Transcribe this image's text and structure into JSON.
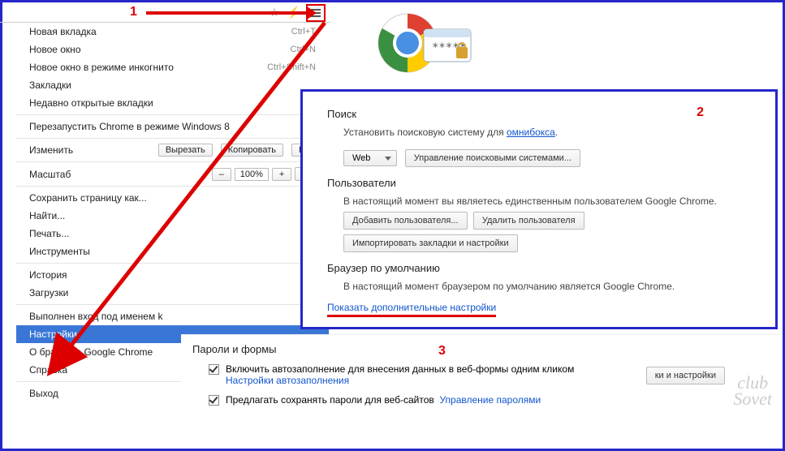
{
  "steps": {
    "one": "1",
    "two": "2",
    "three": "3"
  },
  "menu": {
    "new_tab": {
      "label": "Новая вкладка",
      "shortcut": "Ctrl+T"
    },
    "new_window": {
      "label": "Новое окно",
      "shortcut": "Ctrl+N"
    },
    "incognito": {
      "label": "Новое окно в режиме инкогнито",
      "shortcut": "Ctrl+Shift+N"
    },
    "bookmarks": {
      "label": "Закладки"
    },
    "recent_tabs": {
      "label": "Недавно открытые вкладки"
    },
    "relaunch_win8": {
      "label": "Перезапустить Chrome в режиме Windows 8"
    },
    "edit_label": "Изменить",
    "cut": "Вырезать",
    "copy": "Копировать",
    "paste_prefix": "Вст",
    "zoom_label": "Масштаб",
    "zoom_minus": "–",
    "zoom_value": "100%",
    "zoom_plus": "+",
    "save_page": {
      "label": "Сохранить страницу как..."
    },
    "find": {
      "label": "Найти..."
    },
    "print": {
      "label": "Печать..."
    },
    "tools": {
      "label": "Инструменты"
    },
    "history": {
      "label": "История"
    },
    "downloads": {
      "label": "Загрузки"
    },
    "signed_in_prefix": "Выполнен вход под именем k",
    "settings": {
      "label": "Настройки"
    },
    "about": {
      "label": "О браузере Google Chrome"
    },
    "help": {
      "label": "Справка"
    },
    "exit": {
      "label": "Выход"
    }
  },
  "settings": {
    "search": {
      "heading": "Поиск",
      "desc_prefix": "Установить поисковую систему для ",
      "omnibox_link": "омнибокса",
      "desc_suffix": ".",
      "engine_selected": "Web",
      "manage_btn": "Управление поисковыми системами..."
    },
    "users": {
      "heading": "Пользователи",
      "desc": "В настоящий момент вы являетесь единственным пользователем Google Chrome.",
      "add_btn": "Добавить пользователя...",
      "delete_btn": "Удалить пользователя",
      "import_btn": "Импортировать закладки и настройки"
    },
    "default_browser": {
      "heading": "Браузер по умолчанию",
      "desc": "В настоящий момент браузером по умолчанию является Google Chrome."
    },
    "advanced_link": "Показать дополнительные настройки"
  },
  "passwords": {
    "heading": "Пароли и формы",
    "autofill_label": "Включить автозаполнение для внесения данных в веб-формы одним кликом",
    "autofill_link": "Настройки автозаполнения",
    "offer_save_label": "Предлагать сохранять пароли для веб-сайтов",
    "manage_link": "Управление паролями",
    "overlay_btn_fragment": "ки и настройки"
  },
  "watermark": {
    "line1": "club",
    "line2": "Sovet"
  }
}
